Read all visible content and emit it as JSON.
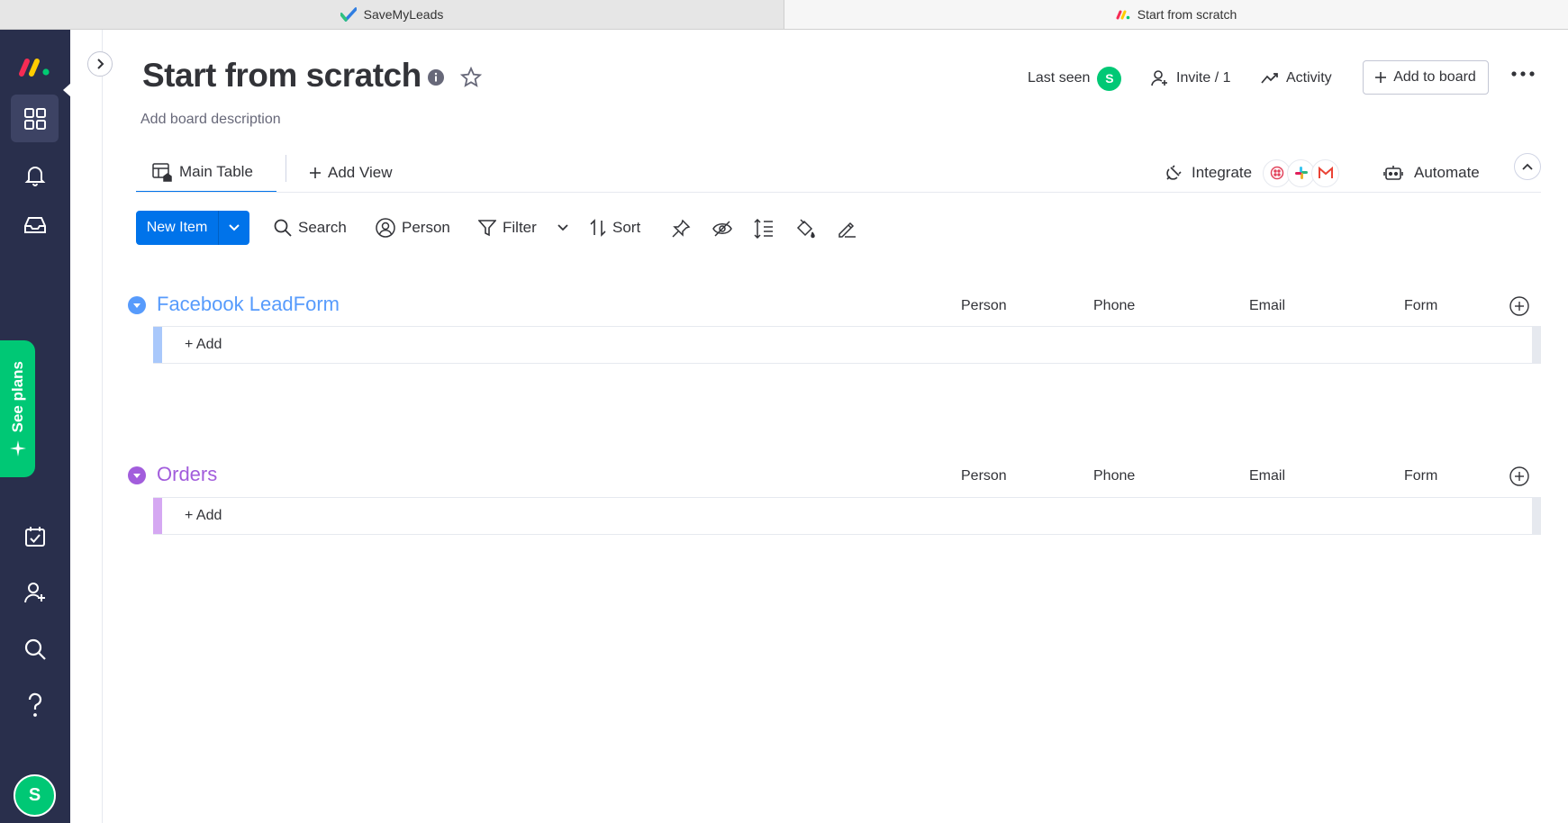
{
  "browser_tabs": [
    {
      "label": "SaveMyLeads"
    },
    {
      "label": "Start from scratch"
    }
  ],
  "board": {
    "title": "Start from scratch",
    "description": "Add board description"
  },
  "header": {
    "last_seen_label": "Last seen",
    "avatar_initial": "S",
    "invite_label": "Invite / 1",
    "activity_label": "Activity",
    "add_to_board_label": "Add to board"
  },
  "views": {
    "main_table": "Main Table",
    "add_view": "Add View",
    "integrate": "Integrate",
    "automate": "Automate"
  },
  "toolbar": {
    "new_item": "New Item",
    "search": "Search",
    "person": "Person",
    "filter": "Filter",
    "sort": "Sort"
  },
  "rail": {
    "see_plans": "See plans",
    "user_initial": "S"
  },
  "groups": [
    {
      "title": "Facebook LeadForm",
      "color": "#579bfc",
      "bar_color": "#a9c8fb",
      "columns": [
        "Person",
        "Phone",
        "Email",
        "Form"
      ],
      "add_label": "+ Add"
    },
    {
      "title": "Orders",
      "color": "#a25ddc",
      "bar_color": "#d5a8f2",
      "columns": [
        "Person",
        "Phone",
        "Email",
        "Form"
      ],
      "add_label": "+ Add"
    }
  ],
  "colors": {
    "primary": "#0073ea",
    "rail": "#292f4c",
    "green": "#00c875"
  }
}
